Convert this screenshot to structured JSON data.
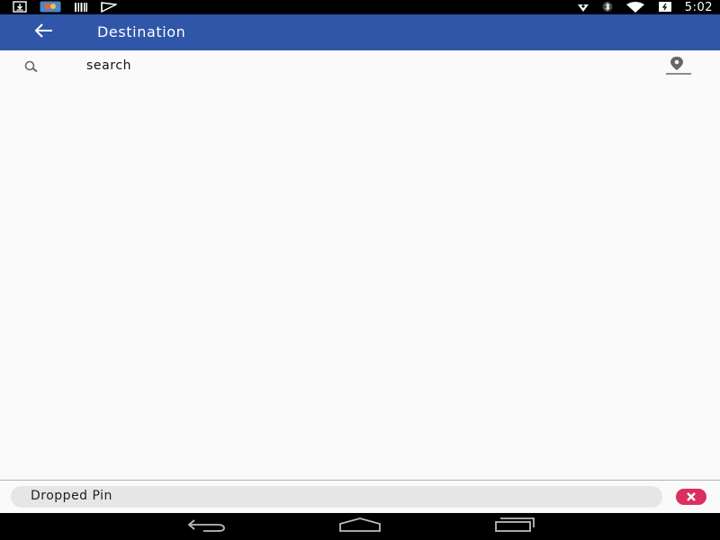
{
  "status_bar": {
    "time": "5:02",
    "left_icons": [
      "download-icon",
      "photos-icon",
      "barcode-icon",
      "flag-icon"
    ],
    "right_icons": [
      "location-icon",
      "bluetooth-icon",
      "wifi-icon",
      "battery-icon"
    ]
  },
  "app_bar": {
    "title": "Destination",
    "back_icon": "arrow-back-icon",
    "color": "#2f56a9"
  },
  "search": {
    "placeholder": "search",
    "value": "",
    "icon": "search-icon",
    "pin_icon": "location-pin-icon"
  },
  "bottom_bar": {
    "label": "Dropped Pin",
    "clear_icon": "close-icon",
    "clear_color": "#d9305f"
  },
  "nav_bar": {
    "buttons": [
      "back-nav-icon",
      "home-nav-icon",
      "recents-nav-icon"
    ]
  }
}
